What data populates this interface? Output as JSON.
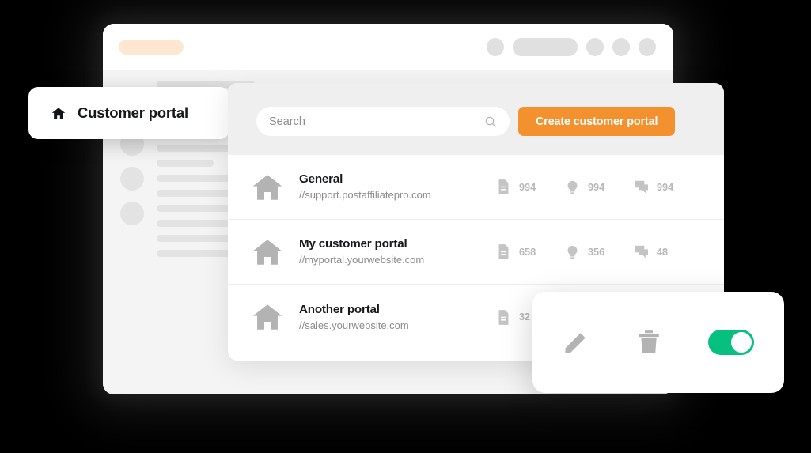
{
  "browser": {
    "url_bar_placeholder": "",
    "toolbar_icons": [
      "circle-icon",
      "address-pill",
      "circle-icon",
      "circle-icon",
      "circle-icon"
    ]
  },
  "portal_header": {
    "icon": "home-icon",
    "title": "Customer portal"
  },
  "toolbar": {
    "search_placeholder": "Search",
    "search_value": "",
    "search_icon": "search-icon",
    "create_label": "Create customer portal"
  },
  "list": {
    "rows": [
      {
        "icon": "home-icon",
        "title": "General",
        "url": "//support.postaffiliatepro.com",
        "stats": [
          {
            "icon": "document-icon",
            "value": "994"
          },
          {
            "icon": "lightbulb-icon",
            "value": "994"
          },
          {
            "icon": "chat-icon",
            "value": "994"
          }
        ]
      },
      {
        "icon": "home-icon",
        "title": "My customer portal",
        "url": "//myportal.yourwebsite.com",
        "stats": [
          {
            "icon": "document-icon",
            "value": "658"
          },
          {
            "icon": "lightbulb-icon",
            "value": "356"
          },
          {
            "icon": "chat-icon",
            "value": "48"
          }
        ]
      },
      {
        "icon": "home-icon",
        "title": "Another portal",
        "url": "//sales.yourwebsite.com",
        "stats": [
          {
            "icon": "document-icon",
            "value": "32"
          }
        ]
      }
    ]
  },
  "action_panel": {
    "edit_icon": "pencil-icon",
    "delete_icon": "trash-icon",
    "toggle_icon": "toggle-switch",
    "toggle_state": "on"
  },
  "colors": {
    "accent_orange": "#f3912e",
    "toggle_green": "#07bf7f",
    "url_pill_peach": "#fde7d2",
    "skeleton_gray": "#e3e3e3",
    "background": "#000000"
  },
  "skeleton": {
    "circle_count": 4,
    "line_count": 11
  }
}
